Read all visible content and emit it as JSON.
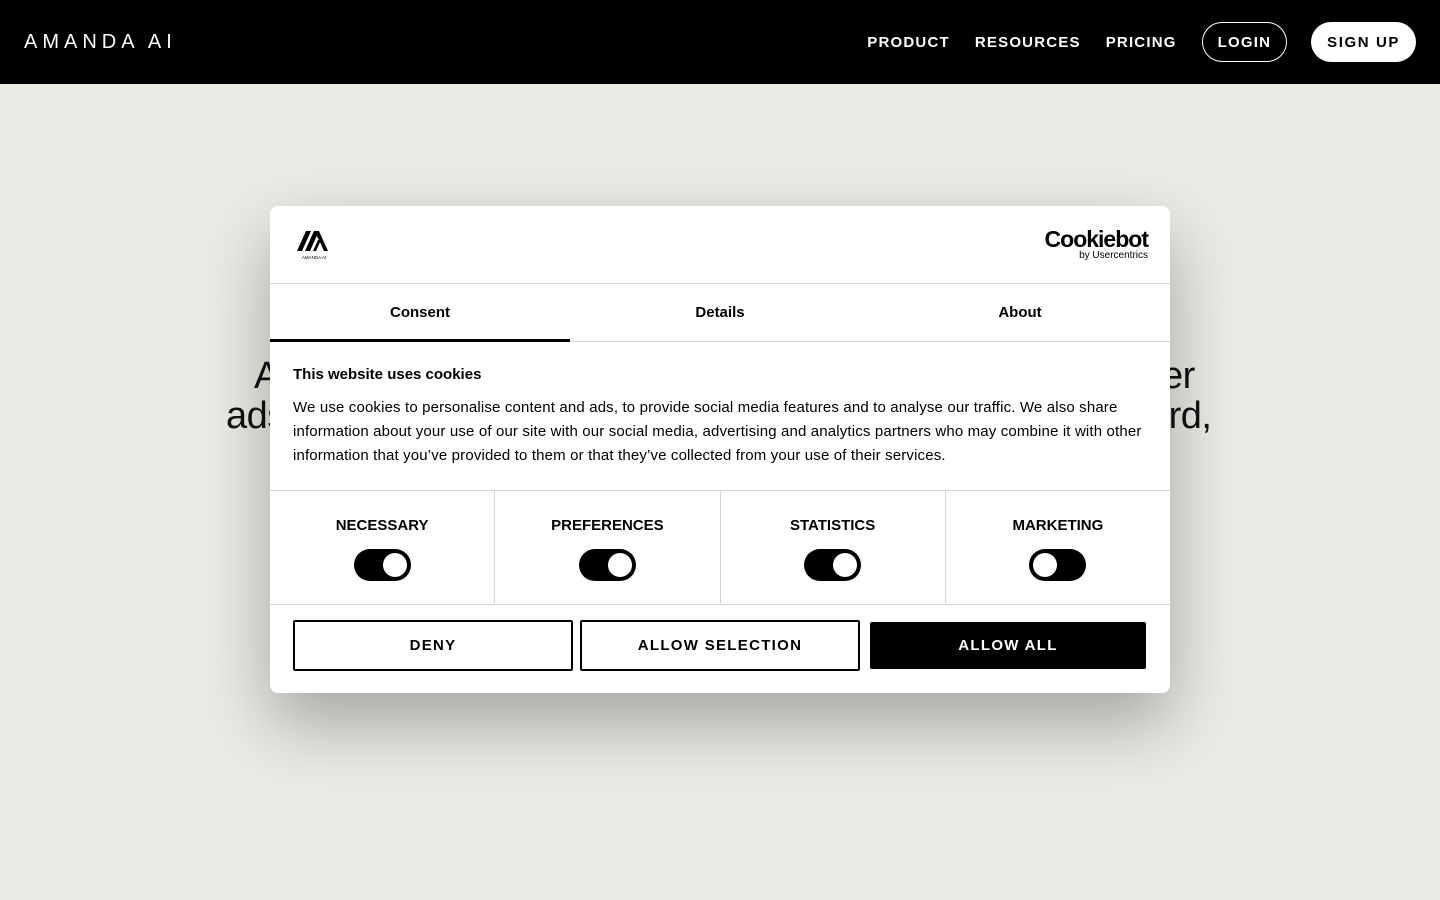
{
  "header": {
    "logo_text": "AMANDA AI",
    "nav": [
      "PRODUCT",
      "RESOURCES",
      "PRICING"
    ],
    "login_label": "LOGIN",
    "signup_label": "SIGN UP"
  },
  "hero": {
    "line1_left": "A",
    "line1_right": "er",
    "line2_left": "ads",
    "line2_right": "ard,"
  },
  "dialog": {
    "brand": "Cookiebot",
    "brand_sub": "by Usercentrics",
    "tabs": [
      "Consent",
      "Details",
      "About"
    ],
    "active_tab": "Consent",
    "title": "This website uses cookies",
    "text": "We use cookies to personalise content and ads, to provide social media features and to analyse our traffic. We also share information about your use of our site with our social media, advertising and analytics partners who may combine it with other information that you’ve provided to them or that they’ve collected from your use of their services.",
    "toggles": [
      {
        "label": "NECESSARY",
        "state": "on"
      },
      {
        "label": "PREFERENCES",
        "state": "on"
      },
      {
        "label": "STATISTICS",
        "state": "on"
      },
      {
        "label": "MARKETING",
        "state": "off"
      }
    ],
    "buttons": {
      "deny": "DENY",
      "allow_selection": "ALLOW SELECTION",
      "allow_all": "ALLOW ALL"
    }
  },
  "colors": {
    "page_bg": "#ebeae5",
    "header_bg": "#000000",
    "accent": "#000000"
  }
}
